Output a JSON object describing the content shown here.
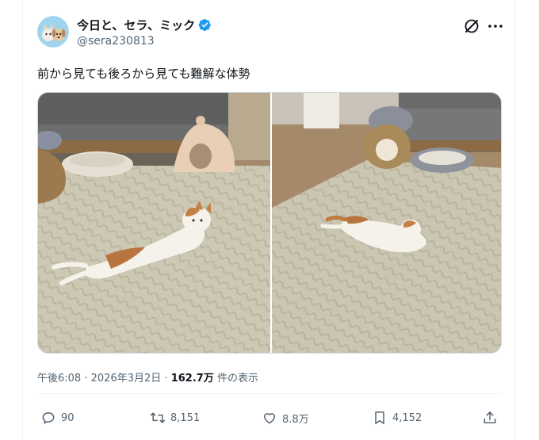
{
  "author": {
    "display_name": "今日と、セラ、ミック",
    "handle": "@sera230813",
    "verified": true,
    "avatar_icon": "cat-dog-avatar-icon"
  },
  "tweet": {
    "text": "前から見ても後ろから見ても難解な体勢"
  },
  "media": {
    "count": 2,
    "photos": [
      "cat-lying-front-view-photo",
      "cat-lying-back-view-photo"
    ]
  },
  "meta": {
    "time": "午後6:08",
    "dot1": "·",
    "date": "2026年3月2日",
    "dot2": "·",
    "views": "162.7万",
    "views_label": "件の表示"
  },
  "actions": {
    "reply_count": "90",
    "retweet_count": "8,151",
    "like_count": "8.8万",
    "bookmark_count": "4,152"
  },
  "colors": {
    "accent": "#1d9bf0",
    "text": "#0f1419",
    "muted": "#536471"
  }
}
